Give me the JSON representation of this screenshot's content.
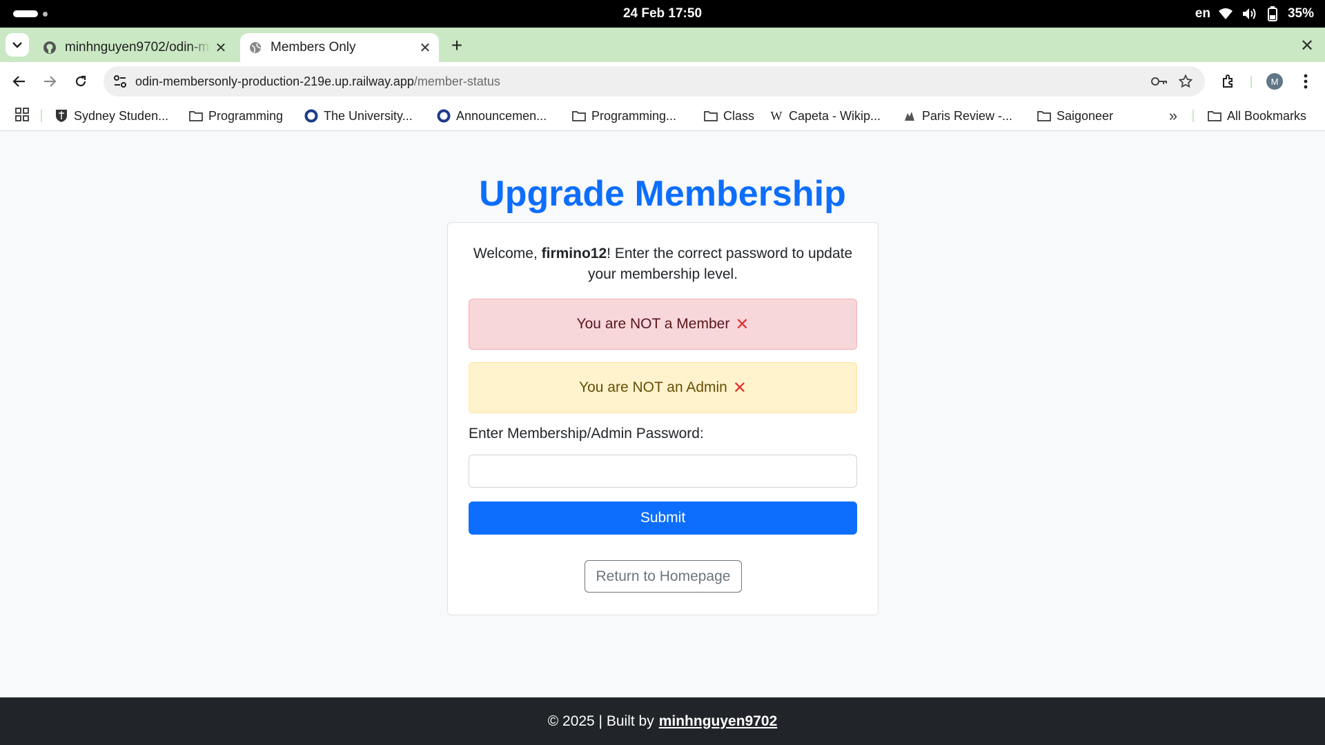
{
  "status_bar": {
    "datetime": "24 Feb  17:50",
    "language": "en",
    "battery": "35%"
  },
  "tabs": [
    {
      "title": "minhnguyen9702/odin-members-only",
      "favicon": "github-icon",
      "active": false
    },
    {
      "title": "Members Only",
      "favicon": "globe-icon",
      "active": true
    }
  ],
  "address_bar": {
    "host": "odin-membersonly-production-219e.up.railway.app",
    "path": "/member-status"
  },
  "bookmarks": [
    {
      "label": "Sydney Studen...",
      "icon": "crest-icon"
    },
    {
      "label": "Programming",
      "icon": "folder-icon"
    },
    {
      "label": "The University...",
      "icon": "ring-icon"
    },
    {
      "label": "Announcemen...",
      "icon": "ring-icon"
    },
    {
      "label": "Programming...",
      "icon": "folder-icon"
    },
    {
      "label": "Class",
      "icon": "folder-icon"
    },
    {
      "label": "Capeta - Wikip...",
      "icon": "wikipedia-icon"
    },
    {
      "label": "Paris Review -...",
      "icon": "paris-review-icon"
    },
    {
      "label": "Saigoneer",
      "icon": "folder-icon"
    }
  ],
  "all_bookmarks_label": "All Bookmarks",
  "profile_initial": "M",
  "page": {
    "title": "Upgrade Membership",
    "welcome_prefix": "Welcome, ",
    "username": "firmino12",
    "welcome_suffix": "! Enter the correct password to update your membership level.",
    "member_status": "You are NOT a Member",
    "admin_status": "You are NOT an Admin",
    "password_label": "Enter Membership/Admin Password:",
    "password_value": "",
    "submit_label": "Submit",
    "return_label": "Return to Homepage"
  },
  "footer": {
    "text": "© 2025 | Built by",
    "author": "minhnguyen9702"
  },
  "colors": {
    "primary": "#0d6efd",
    "danger_bg": "#f8d7da",
    "warning_bg": "#fff3cd",
    "footer_bg": "#212529",
    "tabstrip_bg": "#c9e8c3"
  }
}
